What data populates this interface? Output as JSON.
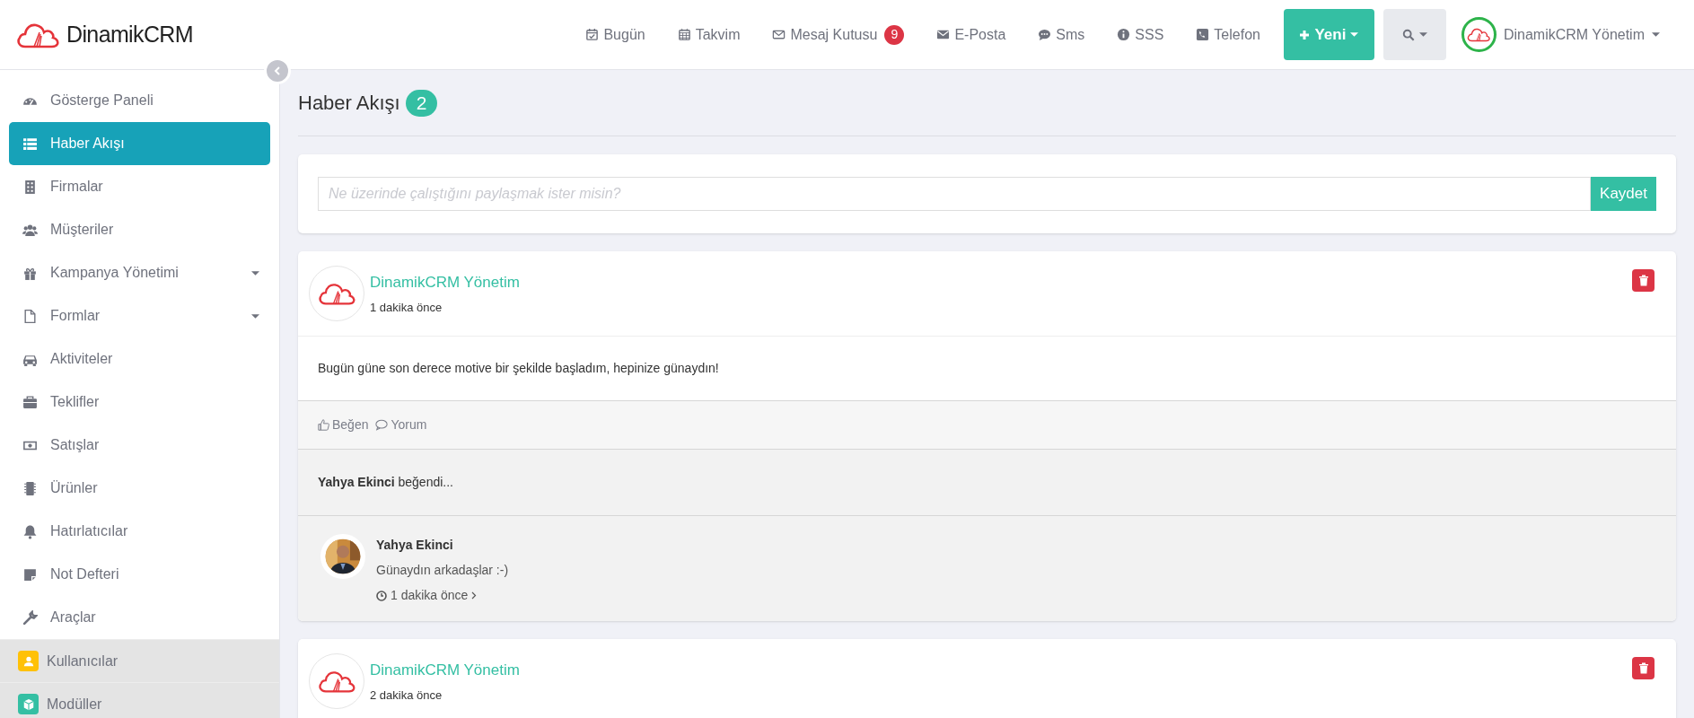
{
  "brand": {
    "name": "DinamikCRM"
  },
  "top_nav": [
    {
      "label": "Bugün"
    },
    {
      "label": "Takvim"
    },
    {
      "label": "Mesaj Kutusu",
      "badge": "9"
    },
    {
      "label": "E-Posta"
    },
    {
      "label": "Sms"
    },
    {
      "label": "SSS"
    },
    {
      "label": "Telefon"
    }
  ],
  "new_button": {
    "label": "Yeni"
  },
  "user_menu": {
    "name": "DinamikCRM Yönetim"
  },
  "sidebar": {
    "items": [
      {
        "label": "Gösterge Paneli",
        "selected": false,
        "has_submenu": false
      },
      {
        "label": "Haber Akışı",
        "selected": true,
        "has_submenu": false
      },
      {
        "label": "Firmalar",
        "selected": false,
        "has_submenu": false
      },
      {
        "label": "Müşteriler",
        "selected": false,
        "has_submenu": false
      },
      {
        "label": "Kampanya Yönetimi",
        "selected": false,
        "has_submenu": true
      },
      {
        "label": "Formlar",
        "selected": false,
        "has_submenu": true
      },
      {
        "label": "Aktiviteler",
        "selected": false,
        "has_submenu": false
      },
      {
        "label": "Teklifler",
        "selected": false,
        "has_submenu": false
      },
      {
        "label": "Satışlar",
        "selected": false,
        "has_submenu": false
      },
      {
        "label": "Ürünler",
        "selected": false,
        "has_submenu": false
      },
      {
        "label": "Hatırlatıcılar",
        "selected": false,
        "has_submenu": false
      },
      {
        "label": "Not Defteri",
        "selected": false,
        "has_submenu": false
      },
      {
        "label": "Araçlar",
        "selected": false,
        "has_submenu": false
      }
    ],
    "modules": [
      {
        "label": "Kullanıcılar",
        "color": "#ffc107"
      },
      {
        "label": "Modüller",
        "color": "#34bfa3"
      }
    ]
  },
  "page": {
    "title": "Haber Akışı",
    "count": "2"
  },
  "composer": {
    "placeholder": "Ne üzerinde çalıştığını paylaşmak ister misin?",
    "button": "Kaydet"
  },
  "posts": [
    {
      "author": "DinamikCRM Yönetim",
      "time": "1 dakika önce",
      "text": "Bugün güne son derece motive bir şekilde başladım, hepinize günaydın!",
      "actions": [
        "Beğen",
        "Yorum"
      ],
      "likes": "**Yahya Ekinci** beğendi...",
      "comments": [
        {
          "author": "Yahya Ekinci",
          "text": "Günaydın arkadaşlar :-)",
          "time": "1 dakika önce"
        }
      ]
    },
    {
      "author": "DinamikCRM Yönetim",
      "time": "2 dakika önce"
    }
  ]
}
